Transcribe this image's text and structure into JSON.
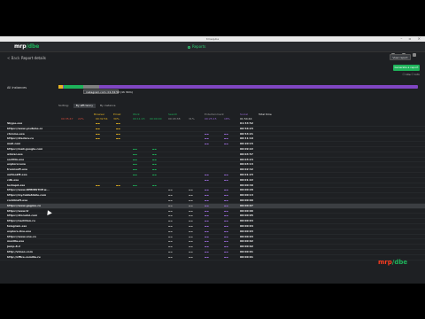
{
  "window": {
    "title": "timeqube"
  },
  "app": {
    "logo_a": "mrp",
    "logo_b": "/dbe",
    "center_title": "Reports"
  },
  "toolbar": {
    "back": "< Back",
    "section": "Report details",
    "action": "View report"
  },
  "green_button": "Generate a report",
  "checkbox_label": "☐ Idle  ☐ Info",
  "timeline": {
    "label": "All instances",
    "tooltip": "instagram.com: 01:34:52  (1h 34m)"
  },
  "sort": {
    "label": "Sorting:",
    "active": "By efficiency",
    "other": "By instance"
  },
  "headers": [
    {
      "text": "Browser",
      "color": "#e6b422"
    },
    {
      "text": "Email",
      "color": "#e6b422"
    },
    {
      "text": "Work",
      "color": "#1eb35a"
    },
    {
      "text": "Search",
      "color": "#1eb35a"
    },
    {
      "text": "Entertainment",
      "color": "#9a9a9a"
    },
    {
      "text": "Social",
      "color": "#9b6bd8"
    },
    {
      "text": "Total time",
      "color": "#e9e9e9"
    }
  ],
  "summary": [
    {
      "text": "00:35:47",
      "color": "#d94c3d"
    },
    {
      "text": "22%",
      "color": "#d94c3d"
    },
    {
      "text": "00:32:54",
      "color": "#e6b422"
    },
    {
      "text": "30%",
      "color": "#e6b422"
    },
    {
      "text": "00:11:15",
      "color": "#1eb35a"
    },
    {
      "text": "00:00:00",
      "color": "#1eb35a"
    },
    {
      "text": "00:43:38",
      "color": "#9a9a9a"
    },
    {
      "text": "31%",
      "color": "#9a9a9a"
    },
    {
      "text": "00:25:15",
      "color": "#9b6bd8"
    },
    {
      "text": "18%",
      "color": "#9b6bd8"
    },
    {
      "text": "01:54:44",
      "color": "#e9e9e9"
    }
  ],
  "rows": [
    {
      "name": "Skype.exe",
      "total": "01:34:52",
      "seg": "y2"
    },
    {
      "name": "https://www.youtube.co",
      "total": "00:56:23",
      "seg": "y2"
    },
    {
      "name": "chrome.exe",
      "total": "00:54:21",
      "seg": "y2p"
    },
    {
      "name": "https://stackov.co",
      "total": "00:41:19",
      "seg": "y2p"
    },
    {
      "name": "mail.com",
      "total": "00:20:15",
      "seg": "p"
    },
    {
      "name": "https://mail.google.com",
      "total": "00:09:22",
      "seg": "g"
    },
    {
      "name": "winrar.exe",
      "total": "00:04:57",
      "seg": "g"
    },
    {
      "name": "sorlitin.exe",
      "total": "00:03:24",
      "seg": "g"
    },
    {
      "name": "explorer.exe",
      "total": "00:03:13",
      "seg": "g"
    },
    {
      "name": "trennsoft.exe",
      "total": "00:02:42",
      "seg": "g"
    },
    {
      "name": "outlookft.exe",
      "total": "00:01:23",
      "seg": "gp"
    },
    {
      "name": "cdb.exe",
      "total": "00:01:22",
      "seg": "p"
    },
    {
      "name": "lockapd.exe",
      "total": "00:00:49",
      "seg": "gy"
    },
    {
      "name": "https://www.DEBINSTOP.w...",
      "total": "00:00:20",
      "seg": "e"
    },
    {
      "name": "https://my.tabletdate.com",
      "total": "00:00:13",
      "seg": "e"
    },
    {
      "name": "rocklinsft.exe",
      "total": "00:00:09",
      "seg": "e"
    },
    {
      "name": "https://www.gagme.co",
      "total": "00:00:07",
      "seg": "e"
    },
    {
      "name": "https://www.tr",
      "total": "00:00:06",
      "seg": "e"
    },
    {
      "name": "https://storedsi.com",
      "total": "00:00:05",
      "seg": "e"
    },
    {
      "name": "https://nachtion.ru",
      "total": "00:00:04",
      "seg": "e"
    },
    {
      "name": "telegram.exe",
      "total": "00:00:04",
      "seg": "e"
    },
    {
      "name": "explore-live.exe",
      "total": "00:00:03",
      "seg": "e"
    },
    {
      "name": "https://www.one.co",
      "total": "00:00:03",
      "seg": "e"
    },
    {
      "name": "mozilla.exe",
      "total": "00:00:02",
      "seg": "e"
    },
    {
      "name": "jump-8.rl",
      "total": "00:00:02",
      "seg": "e"
    },
    {
      "name": "http://vimeo.com",
      "total": "00:00:01",
      "seg": "e"
    },
    {
      "name": "http://office.camilia.ru",
      "total": "00:00:01",
      "seg": "e"
    }
  ],
  "watermark": {
    "a": "mrp",
    "b": "/dbe"
  }
}
